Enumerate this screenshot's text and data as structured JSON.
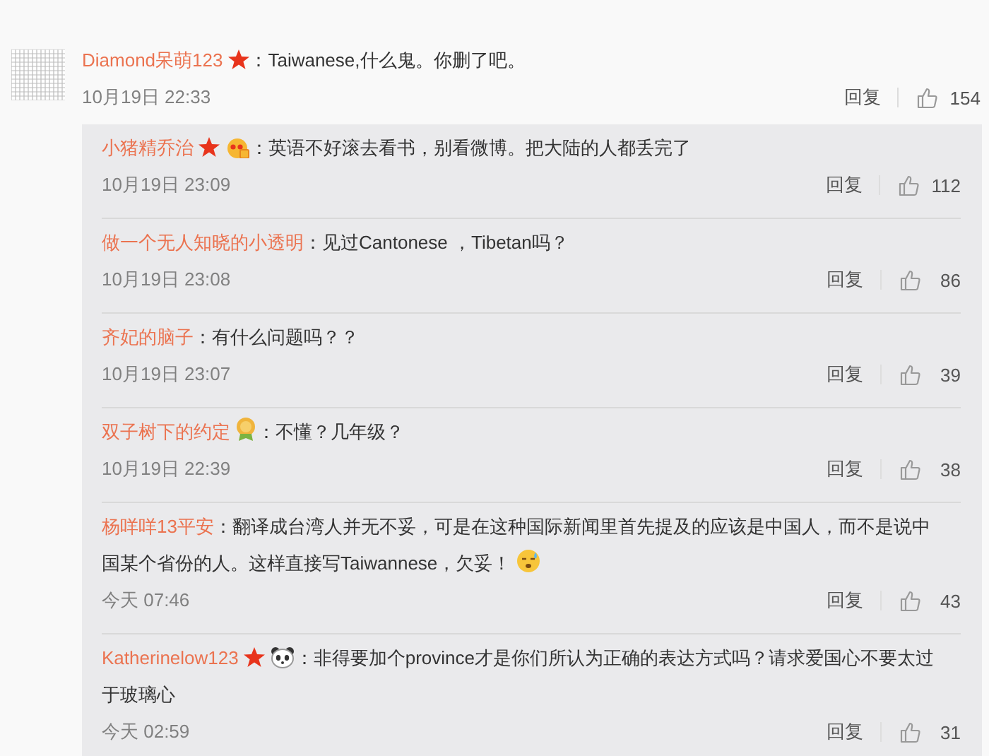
{
  "comment": {
    "author": "Diamond呆萌123",
    "badges": [
      {
        "kind": "star"
      }
    ],
    "text": "：Taiwanese,什么鬼。你删了吧。",
    "time": "10月19日 22:33",
    "reply_label": "回复",
    "likes": "154"
  },
  "replies": [
    {
      "author": "小猪精乔治",
      "badges": [
        {
          "kind": "star"
        },
        {
          "kind": "fan"
        }
      ],
      "text": "：英语不好滚去看书，别看微博。把大陆的人都丢完了",
      "time": "10月19日 23:09",
      "reply_label": "回复",
      "likes": "112"
    },
    {
      "author": "做一个无人知晓的小透明",
      "text": "：见过Cantonese ，Tibetan吗？",
      "time": "10月19日 23:08",
      "reply_label": "回复",
      "likes": "86"
    },
    {
      "author": "齐妃的脑子",
      "text": "：有什么问题吗？？",
      "time": "10月19日 23:07",
      "reply_label": "回复",
      "likes": "39"
    },
    {
      "author": "双子树下的约定",
      "badges": [
        {
          "kind": "medal"
        }
      ],
      "text": "：不懂？几年级？",
      "time": "10月19日 22:39",
      "reply_label": "回复",
      "likes": "38"
    },
    {
      "author": "杨咩咩13平安",
      "text": "：翻译成台湾人并无不妥，可是在这种国际新闻里首先提及的应该是中国人，而不是说中国某个省份的人。这样直接写Taiwannese，欠妥！",
      "trailing_icon": {
        "kind": "sweat"
      },
      "time": "今天 07:46",
      "reply_label": "回复",
      "likes": "43"
    },
    {
      "author": "Katherinelow123",
      "badges": [
        {
          "kind": "star"
        },
        {
          "kind": "panda"
        }
      ],
      "text": "：非得要加个province才是你们所认为正确的表达方式吗？请求爱国心不要太过于玻璃心",
      "time": "今天 02:59",
      "reply_label": "回复",
      "likes": "31"
    }
  ]
}
